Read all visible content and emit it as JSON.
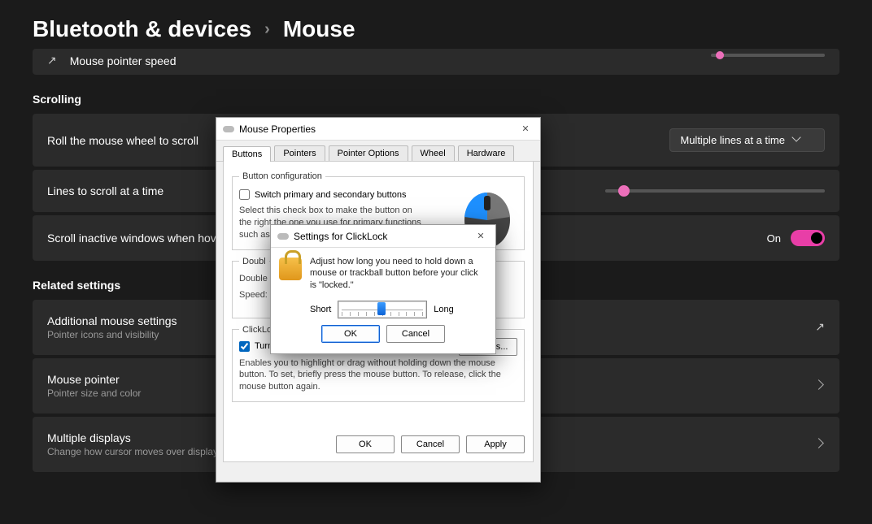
{
  "breadcrumb": {
    "parent": "Bluetooth & devices",
    "current": "Mouse"
  },
  "speed_card": {
    "title": "Mouse pointer speed"
  },
  "section_scrolling": "Scrolling",
  "scroll_wheel": {
    "title": "Roll the mouse wheel to scroll",
    "value": "Multiple lines at a time"
  },
  "lines_card": {
    "title": "Lines to scroll at a time"
  },
  "inactive_card": {
    "title": "Scroll inactive windows when hove",
    "state": "On"
  },
  "section_related": "Related settings",
  "addl": {
    "title": "Additional mouse settings",
    "sub": "Pointer icons and visibility"
  },
  "pointer": {
    "title": "Mouse pointer",
    "sub": "Pointer size and color"
  },
  "multi": {
    "title": "Multiple displays",
    "sub": "Change how cursor moves over display boundaries"
  },
  "mp": {
    "title": "Mouse Properties",
    "tabs": [
      "Buttons",
      "Pointers",
      "Pointer Options",
      "Wheel",
      "Hardware"
    ],
    "fs1": "Button configuration",
    "switch_label": "Switch primary and secondary buttons",
    "switch_desc": "Select this check box to make the button on the right the one you use for primary functions such as sele",
    "fs2": "Doubl",
    "dbl_desc": "Double   a folder d   setting,",
    "speed_label": "Speed:",
    "fs3": "ClickLock",
    "cl_chk": "Turn on ClickLock",
    "cl_btn": "Settings...",
    "cl_desc": "Enables you to highlight or drag without holding down the mouse button. To set, briefly press the mouse button. To release, click the mouse button again.",
    "ok": "OK",
    "cancel": "Cancel",
    "apply": "Apply"
  },
  "cl": {
    "title": "Settings for ClickLock",
    "desc": "Adjust how long you need to hold down a mouse or trackball button before your click is \"locked.\"",
    "short": "Short",
    "long": "Long",
    "ok": "OK",
    "cancel": "Cancel"
  }
}
